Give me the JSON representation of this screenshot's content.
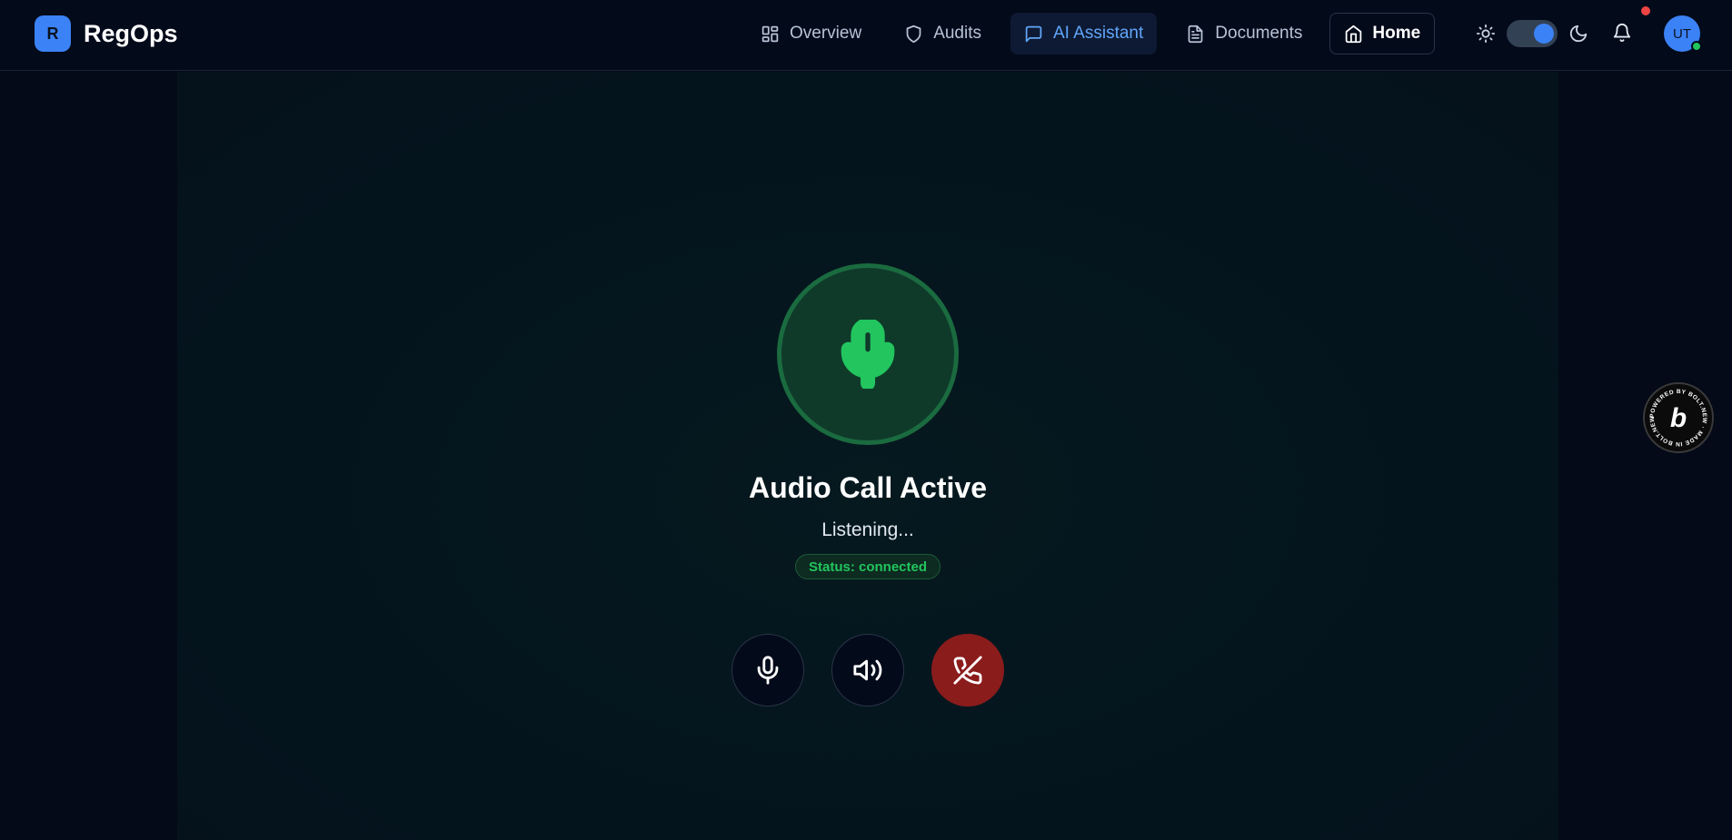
{
  "brand": {
    "logo_letter": "R",
    "name": "RegOps"
  },
  "nav": {
    "items": [
      {
        "label": "Overview",
        "icon": "layout-grid-icon"
      },
      {
        "label": "Audits",
        "icon": "shield-icon"
      },
      {
        "label": "AI Assistant",
        "icon": "message-square-icon",
        "active": true
      },
      {
        "label": "Documents",
        "icon": "file-text-icon"
      }
    ],
    "home_label": "Home"
  },
  "header": {
    "theme_toggle": {
      "light_icon": "sun-icon",
      "dark_icon": "moon-icon",
      "dark_mode": true
    },
    "notifications_icon": "bell-icon",
    "avatar_initials": "UT"
  },
  "call": {
    "title": "Audio Call Active",
    "subtitle": "Listening...",
    "status": "Status: connected",
    "controls": [
      {
        "name": "mute",
        "icon": "mic-icon"
      },
      {
        "name": "speaker",
        "icon": "volume-icon"
      },
      {
        "name": "hang-up",
        "icon": "phone-off-icon"
      }
    ]
  },
  "badge": {
    "text": "POWERED BY BOLT.NEW · MADE IN BOLT.NEW",
    "letter": "b"
  },
  "colors": {
    "accent": "#3b82f6",
    "active_nav_text": "#60a5fa",
    "success": "#22c55e",
    "danger": "#8b1c1c",
    "background": "#040a18"
  }
}
